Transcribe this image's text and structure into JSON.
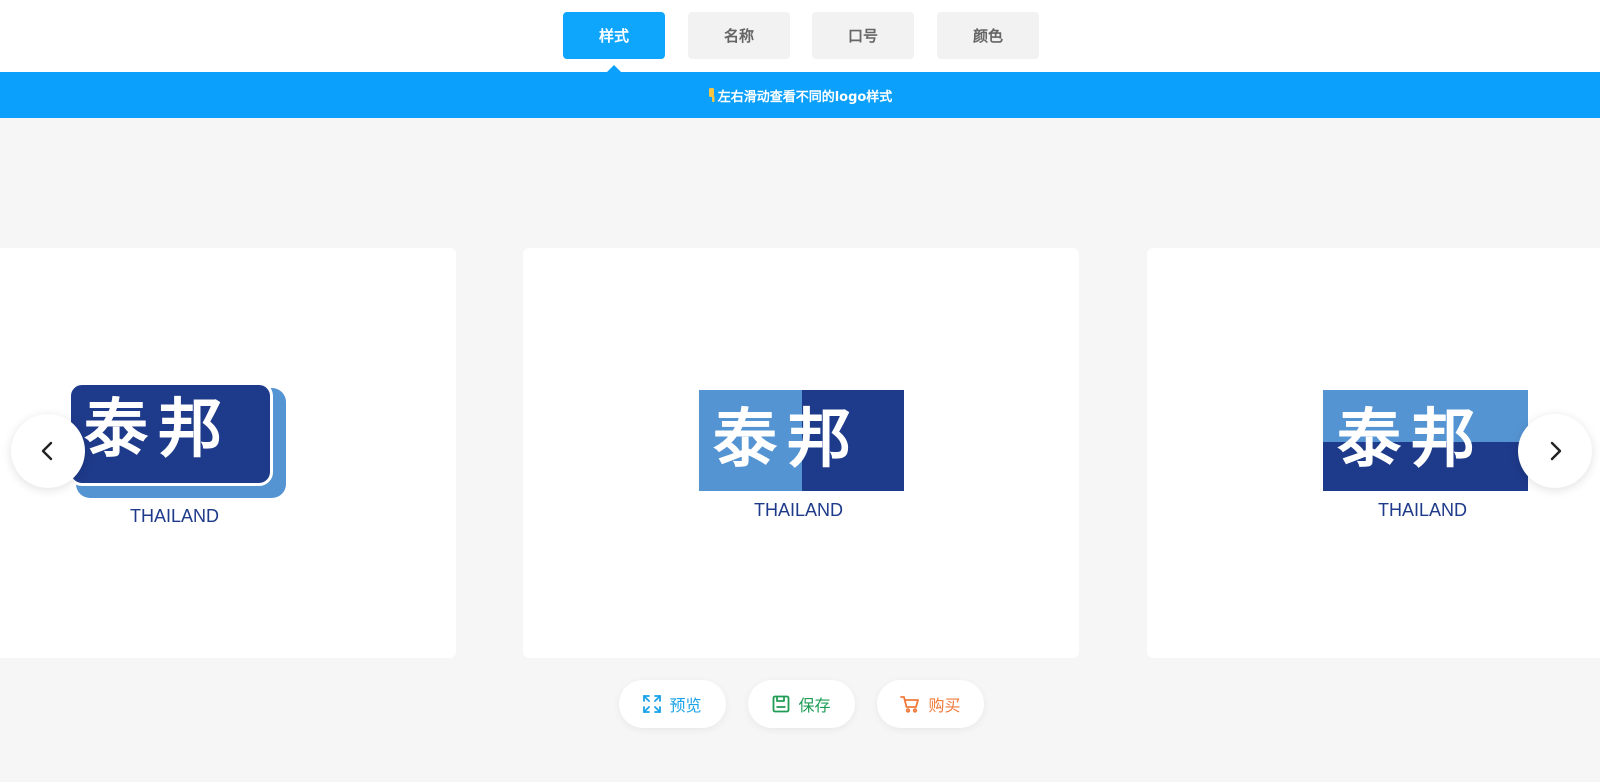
{
  "tabs": [
    {
      "label": "样式",
      "active": true
    },
    {
      "label": "名称",
      "active": false
    },
    {
      "label": "口号",
      "active": false
    },
    {
      "label": "颜色",
      "active": false
    }
  ],
  "hint": {
    "text": "左右滑动查看不同的logo样式",
    "icon": "pointing-hand-icon"
  },
  "logos": [
    {
      "chinese": "泰邦",
      "english": "THAILAND",
      "style": "rounded-badge"
    },
    {
      "chinese": "泰邦",
      "english": "THAILAND",
      "style": "split-vertical"
    },
    {
      "chinese": "泰邦",
      "english": "THAILAND",
      "style": "split-horizontal"
    }
  ],
  "nav": {
    "prev_icon": "chevron-left-icon",
    "next_icon": "chevron-right-icon"
  },
  "actions": [
    {
      "label": "预览",
      "icon": "expand-icon",
      "color": "#1aa3e8"
    },
    {
      "label": "保存",
      "icon": "save-icon",
      "color": "#1f9d55"
    },
    {
      "label": "购买",
      "icon": "cart-icon",
      "color": "#f07a3c"
    }
  ],
  "colors": {
    "accent": "#0aa0fb",
    "logo_dark": "#1e3a8a",
    "logo_light": "#5594d3"
  }
}
